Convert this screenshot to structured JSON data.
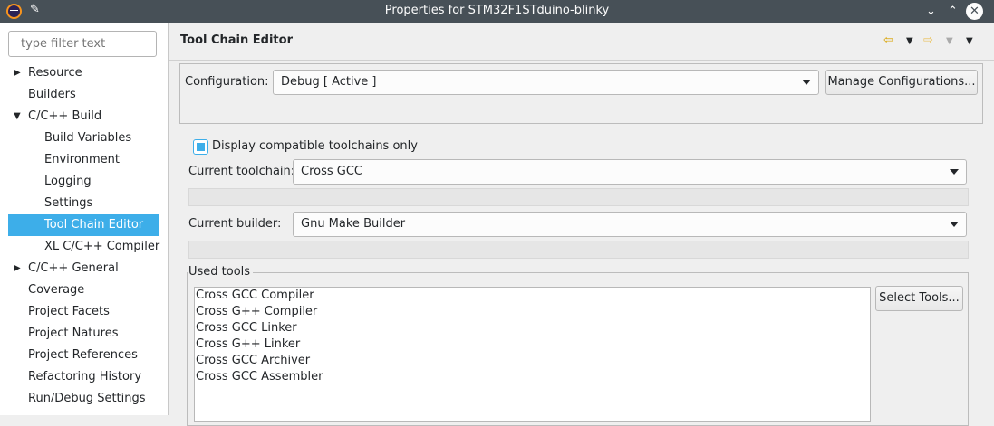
{
  "window": {
    "title": "Properties for STM32F1STduino-blinky",
    "minimize_glyph": "⌄",
    "maximize_glyph": "⌃",
    "close_glyph": "✕"
  },
  "sidebar": {
    "filter_placeholder": "type filter text",
    "items": [
      {
        "label": "Resource",
        "expandable": true,
        "expanded": false
      },
      {
        "label": "Builders"
      },
      {
        "label": "C/C++ Build",
        "expandable": true,
        "expanded": true
      },
      {
        "label": "Build Variables"
      },
      {
        "label": "Environment"
      },
      {
        "label": "Logging"
      },
      {
        "label": "Settings"
      },
      {
        "label": "Tool Chain Editor",
        "selected": true
      },
      {
        "label": "XL C/C++ Compiler"
      },
      {
        "label": "C/C++ General",
        "expandable": true,
        "expanded": false
      },
      {
        "label": "Coverage"
      },
      {
        "label": "Project Facets"
      },
      {
        "label": "Project Natures"
      },
      {
        "label": "Project References"
      },
      {
        "label": "Refactoring History"
      },
      {
        "label": "Run/Debug Settings"
      }
    ]
  },
  "header": {
    "title": "Tool Chain Editor",
    "icons": [
      "back-arrow-icon",
      "forward-arrow-icon",
      "view-menu-icon"
    ]
  },
  "configuration": {
    "label": "Configuration:",
    "value": "Debug  [ Active ]",
    "manage_button": "Manage Configurations..."
  },
  "toolchain": {
    "compatible_only_label": "Display compatible toolchains only",
    "compatible_only_checked": true,
    "current_toolchain_label": "Current toolchain:",
    "current_toolchain_value": "Cross GCC",
    "current_builder_label": "Current builder:",
    "current_builder_value": "Gnu Make Builder"
  },
  "used_tools": {
    "legend": "Used tools",
    "items": [
      "Cross GCC Compiler",
      "Cross G++ Compiler",
      "Cross GCC Linker",
      "Cross G++ Linker",
      "Cross GCC Archiver",
      "Cross GCC Assembler"
    ],
    "select_button": "Select Tools..."
  },
  "colors": {
    "titlebar": "#475057",
    "selection": "#3daee9",
    "background": "#efefef"
  }
}
